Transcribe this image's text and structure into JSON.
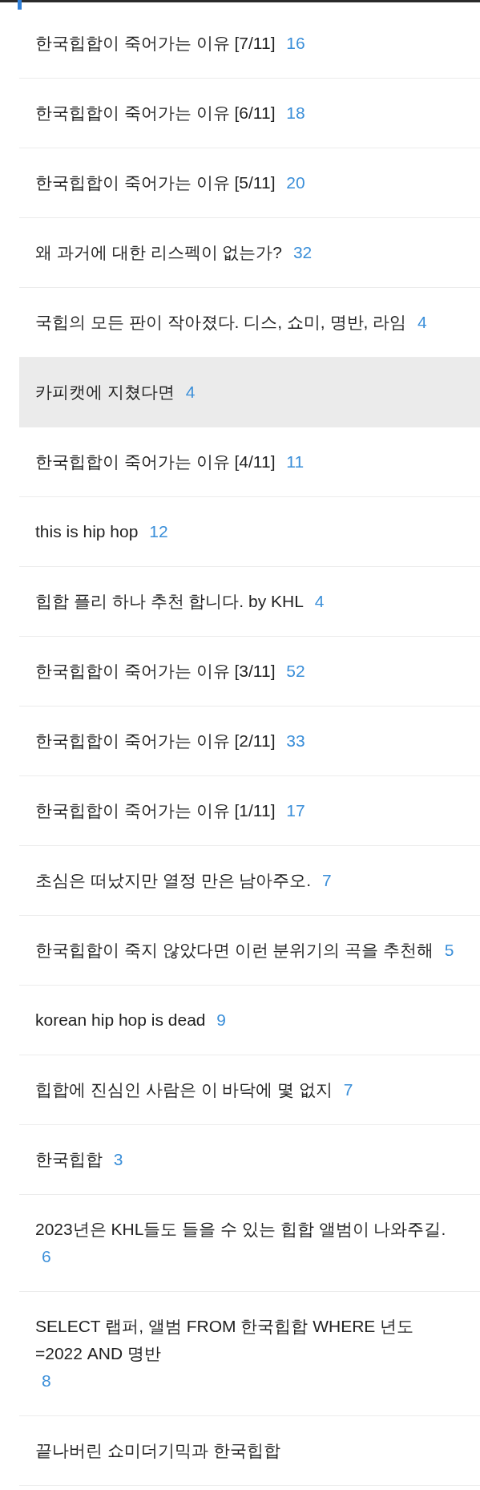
{
  "posts": [
    {
      "title": "한국힙합이 죽어가는 이유 [7/11]",
      "comments": "16",
      "selected": false
    },
    {
      "title": "한국힙합이 죽어가는 이유 [6/11]",
      "comments": "18",
      "selected": false
    },
    {
      "title": "한국힙합이 죽어가는 이유 [5/11]",
      "comments": "20",
      "selected": false
    },
    {
      "title": "왜 과거에 대한 리스펙이 없는가?",
      "comments": "32",
      "selected": false
    },
    {
      "title": "국힙의 모든 판이 작아졌다. 디스, 쇼미, 명반, 라임",
      "comments": "4",
      "selected": false
    },
    {
      "title": "카피캣에 지쳤다면",
      "comments": "4",
      "selected": true
    },
    {
      "title": "한국힙합이 죽어가는 이유 [4/11]",
      "comments": "11",
      "selected": false
    },
    {
      "title": "this is hip hop",
      "comments": "12",
      "selected": false
    },
    {
      "title": "힙합 플리 하나 추천 합니다. by KHL",
      "comments": "4",
      "selected": false
    },
    {
      "title": "한국힙합이 죽어가는 이유 [3/11]",
      "comments": "52",
      "selected": false
    },
    {
      "title": "한국힙합이 죽어가는 이유 [2/11]",
      "comments": "33",
      "selected": false
    },
    {
      "title": "한국힙합이 죽어가는 이유 [1/11]",
      "comments": "17",
      "selected": false
    },
    {
      "title": "초심은 떠났지만 열정 만은 남아주오.",
      "comments": "7",
      "selected": false
    },
    {
      "title": "한국힙합이 죽지 않았다면 이런 분위기의 곡을 추천해",
      "comments": "5",
      "selected": false
    },
    {
      "title": "korean hip hop is dead",
      "comments": "9",
      "selected": false
    },
    {
      "title": "힙합에 진심인 사람은 이 바닥에 몇 없지",
      "comments": "7",
      "selected": false
    },
    {
      "title": "한국힙합",
      "comments": "3",
      "selected": false
    },
    {
      "title": "2023년은 KHL들도 들을 수 있는 힙합 앨범이 나와주길.",
      "comments": "6",
      "selected": false
    },
    {
      "title": "SELECT 랩퍼, 앨범 FROM 한국힙합 WHERE 년도 =2022 AND 명반",
      "comments": "8",
      "selected": false
    },
    {
      "title": "끝나버린 쇼미더기믹과 한국힙합",
      "selected": false
    }
  ]
}
